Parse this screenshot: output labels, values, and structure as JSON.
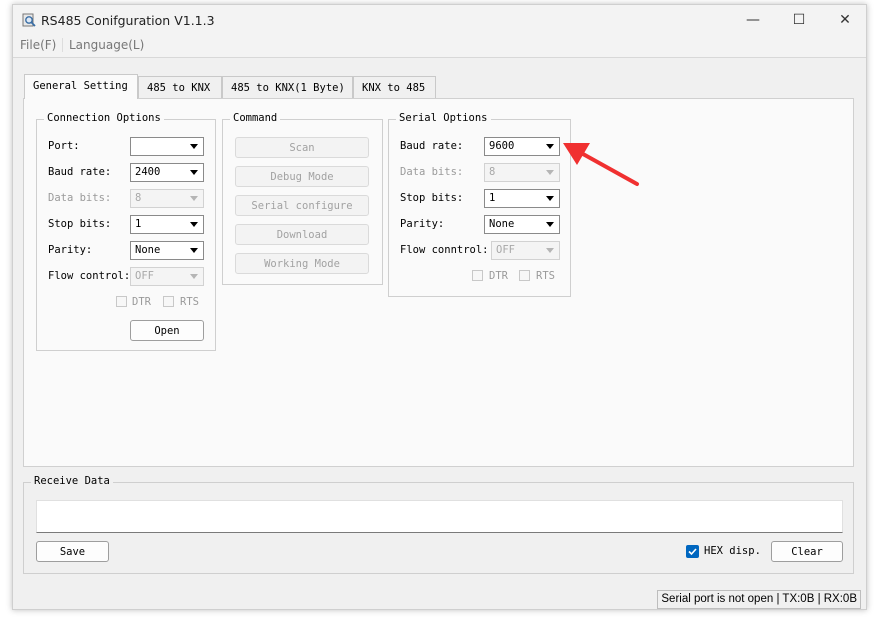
{
  "window": {
    "title": "RS485 Conifguration V1.1.3",
    "controls": {
      "minimize": "—",
      "maximize": "☐",
      "close": "✕"
    }
  },
  "menu": {
    "file": "File(F)",
    "language": "Language(L)"
  },
  "tabs": [
    "General Setting",
    "485 to KNX",
    "485 to KNX(1 Byte)",
    "KNX to 485"
  ],
  "connection": {
    "title": "Connection Options",
    "port_label": "Port:",
    "port_value": "",
    "baud_label": "Baud rate:",
    "baud_value": "2400",
    "data_bits_label": "Data bits:",
    "data_bits_value": "8",
    "stop_bits_label": "Stop bits:",
    "stop_bits_value": "1",
    "parity_label": "Parity:",
    "parity_value": "None",
    "flow_label": "Flow control:",
    "flow_value": "OFF",
    "dtr_label": "DTR",
    "rts_label": "RTS",
    "open_button": "Open"
  },
  "command": {
    "title": "Command",
    "buttons": [
      "Scan",
      "Debug Mode",
      "Serial configure",
      "Download",
      "Working Mode"
    ]
  },
  "serial": {
    "title": "Serial Options",
    "baud_label": "Baud rate:",
    "baud_value": "9600",
    "data_bits_label": "Data bits:",
    "data_bits_value": "8",
    "stop_bits_label": "Stop bits:",
    "stop_bits_value": "1",
    "parity_label": "Parity:",
    "parity_value": "None",
    "flow_label": "Flow conntrol:",
    "flow_value": "OFF",
    "dtr_label": "DTR",
    "rts_label": "RTS"
  },
  "receive": {
    "title": "Receive Data",
    "content": "",
    "save_button": "Save",
    "hex_label": "HEX disp.",
    "hex_checked": true,
    "clear_button": "Clear"
  },
  "status": "Serial port is not open | TX:0B | RX:0B",
  "colors": {
    "accent": "#0067c0",
    "annotation_arrow": "#f03030"
  },
  "icons": {
    "app": "magnifier-doc-icon",
    "annotation": "red-arrow-icon"
  }
}
